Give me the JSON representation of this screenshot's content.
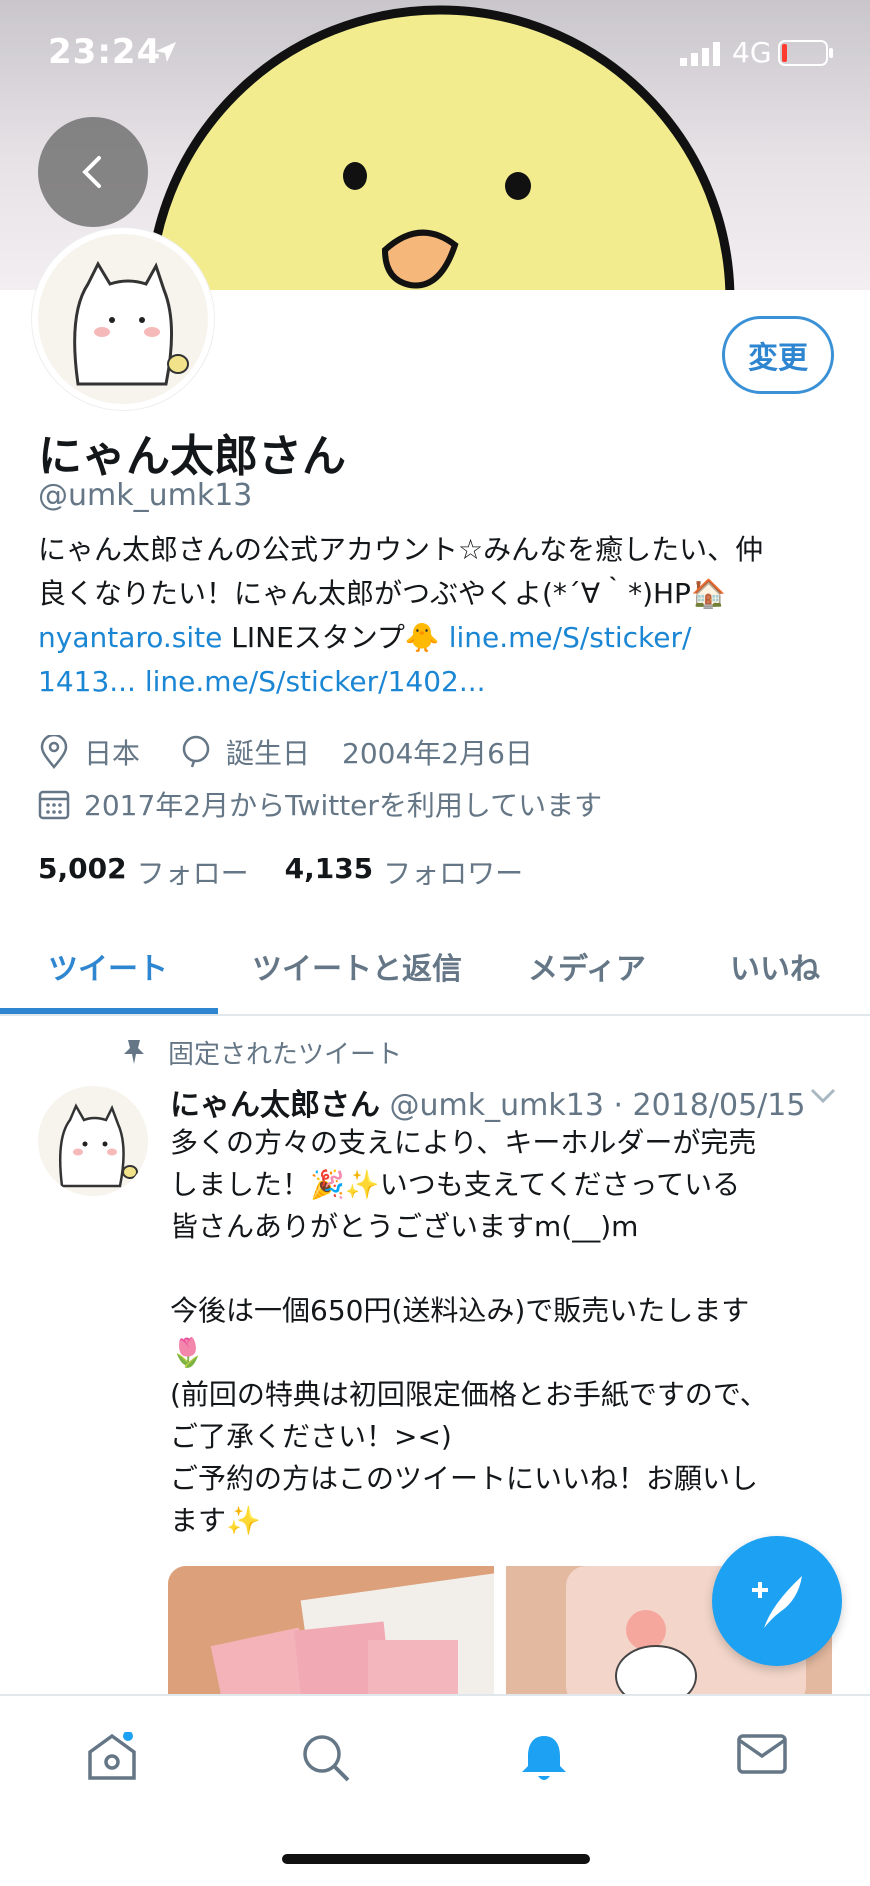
{
  "status_bar": {
    "time": "23:24",
    "network": "4G"
  },
  "profile": {
    "edit_label": "変更",
    "display_name": "にゃん太郎さん",
    "handle": "@umk_umk13",
    "bio_line1": "にゃん太郎さんの公式アカウント☆みんなを癒したい、仲",
    "bio_line2": "良くなりたい！にゃん太郎がつぶやくよ(*´∀｀*)HP🏠",
    "bio_link1": "nyantaro.site",
    "bio_text3": " LINEスタンプ🐥 ",
    "bio_link2": "line.me/S/sticker/",
    "bio_link3": "1413...",
    "bio_link4": "line.me/S/sticker/1402...",
    "location": "日本",
    "birthday_label": "誕生日",
    "birthday": "2004年2月6日",
    "joined": "2017年2月からTwitterを利用しています",
    "following_count": "5,002",
    "following_label": "フォロー",
    "followers_count": "4,135",
    "followers_label": "フォロワー"
  },
  "tabs": [
    {
      "label": "ツイート"
    },
    {
      "label": "ツイートと返信"
    },
    {
      "label": "メディア"
    },
    {
      "label": "いいね"
    }
  ],
  "tweet": {
    "pinned_label": "固定されたツイート",
    "author": "にゃん太郎さん",
    "meta": " @umk_umk13 · 2018/05/15",
    "body": "多くの方々の支えにより、キーホルダーが完売\nしました！🎉✨いつも支えてくださっている\n皆さんありがとうございますm(__)m\n\n今後は一個650円(送料込み)で販売いたします\n🌷\n(前回の特典は初回限定価格とお手紙ですので、\nご了承ください！><)\nご予約の方はこのツイートにいいね！お願いし\nます✨"
  },
  "colors": {
    "accent": "#1da1f2",
    "link": "#1b86d3",
    "muted": "#657786"
  },
  "icons": {
    "nav": [
      "home-icon",
      "search-icon",
      "bell-icon",
      "mail-icon"
    ]
  }
}
